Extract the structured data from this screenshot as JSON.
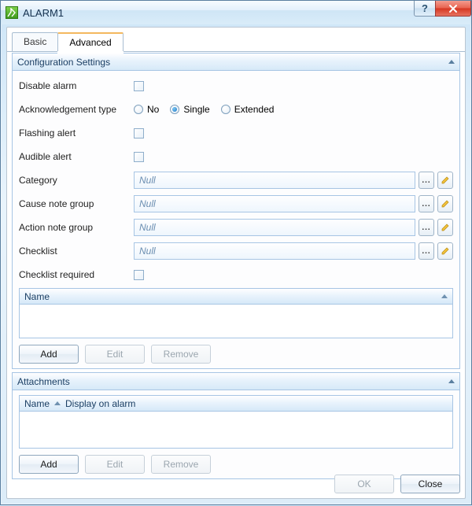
{
  "window": {
    "title": "ALARM1"
  },
  "tabs": {
    "basic": "Basic",
    "advanced": "Advanced",
    "active": "advanced"
  },
  "sections": {
    "config": {
      "title": "Configuration Settings",
      "fields": {
        "disable_alarm": {
          "label": "Disable alarm",
          "checked": false
        },
        "ack_type": {
          "label": "Acknowledgement type",
          "options": {
            "no": "No",
            "single": "Single",
            "extended": "Extended"
          },
          "selected": "single"
        },
        "flashing_alert": {
          "label": "Flashing alert",
          "checked": false
        },
        "audible_alert": {
          "label": "Audible alert",
          "checked": false
        },
        "category": {
          "label": "Category",
          "value": "Null"
        },
        "cause_note_group": {
          "label": "Cause note group",
          "value": "Null"
        },
        "action_note_group": {
          "label": "Action note group",
          "value": "Null"
        },
        "checklist": {
          "label": "Checklist",
          "value": "Null"
        },
        "checklist_required": {
          "label": "Checklist required",
          "checked": false
        }
      },
      "checklist_grid": {
        "columns": {
          "name": "Name"
        },
        "rows": []
      },
      "buttons": {
        "add": "Add",
        "edit": "Edit",
        "remove": "Remove"
      }
    },
    "attachments": {
      "title": "Attachments",
      "grid": {
        "columns": {
          "name": "Name",
          "display": "Display on alarm"
        },
        "rows": []
      },
      "buttons": {
        "add": "Add",
        "edit": "Edit",
        "remove": "Remove"
      }
    }
  },
  "footer": {
    "ok": "OK",
    "close": "Close"
  }
}
